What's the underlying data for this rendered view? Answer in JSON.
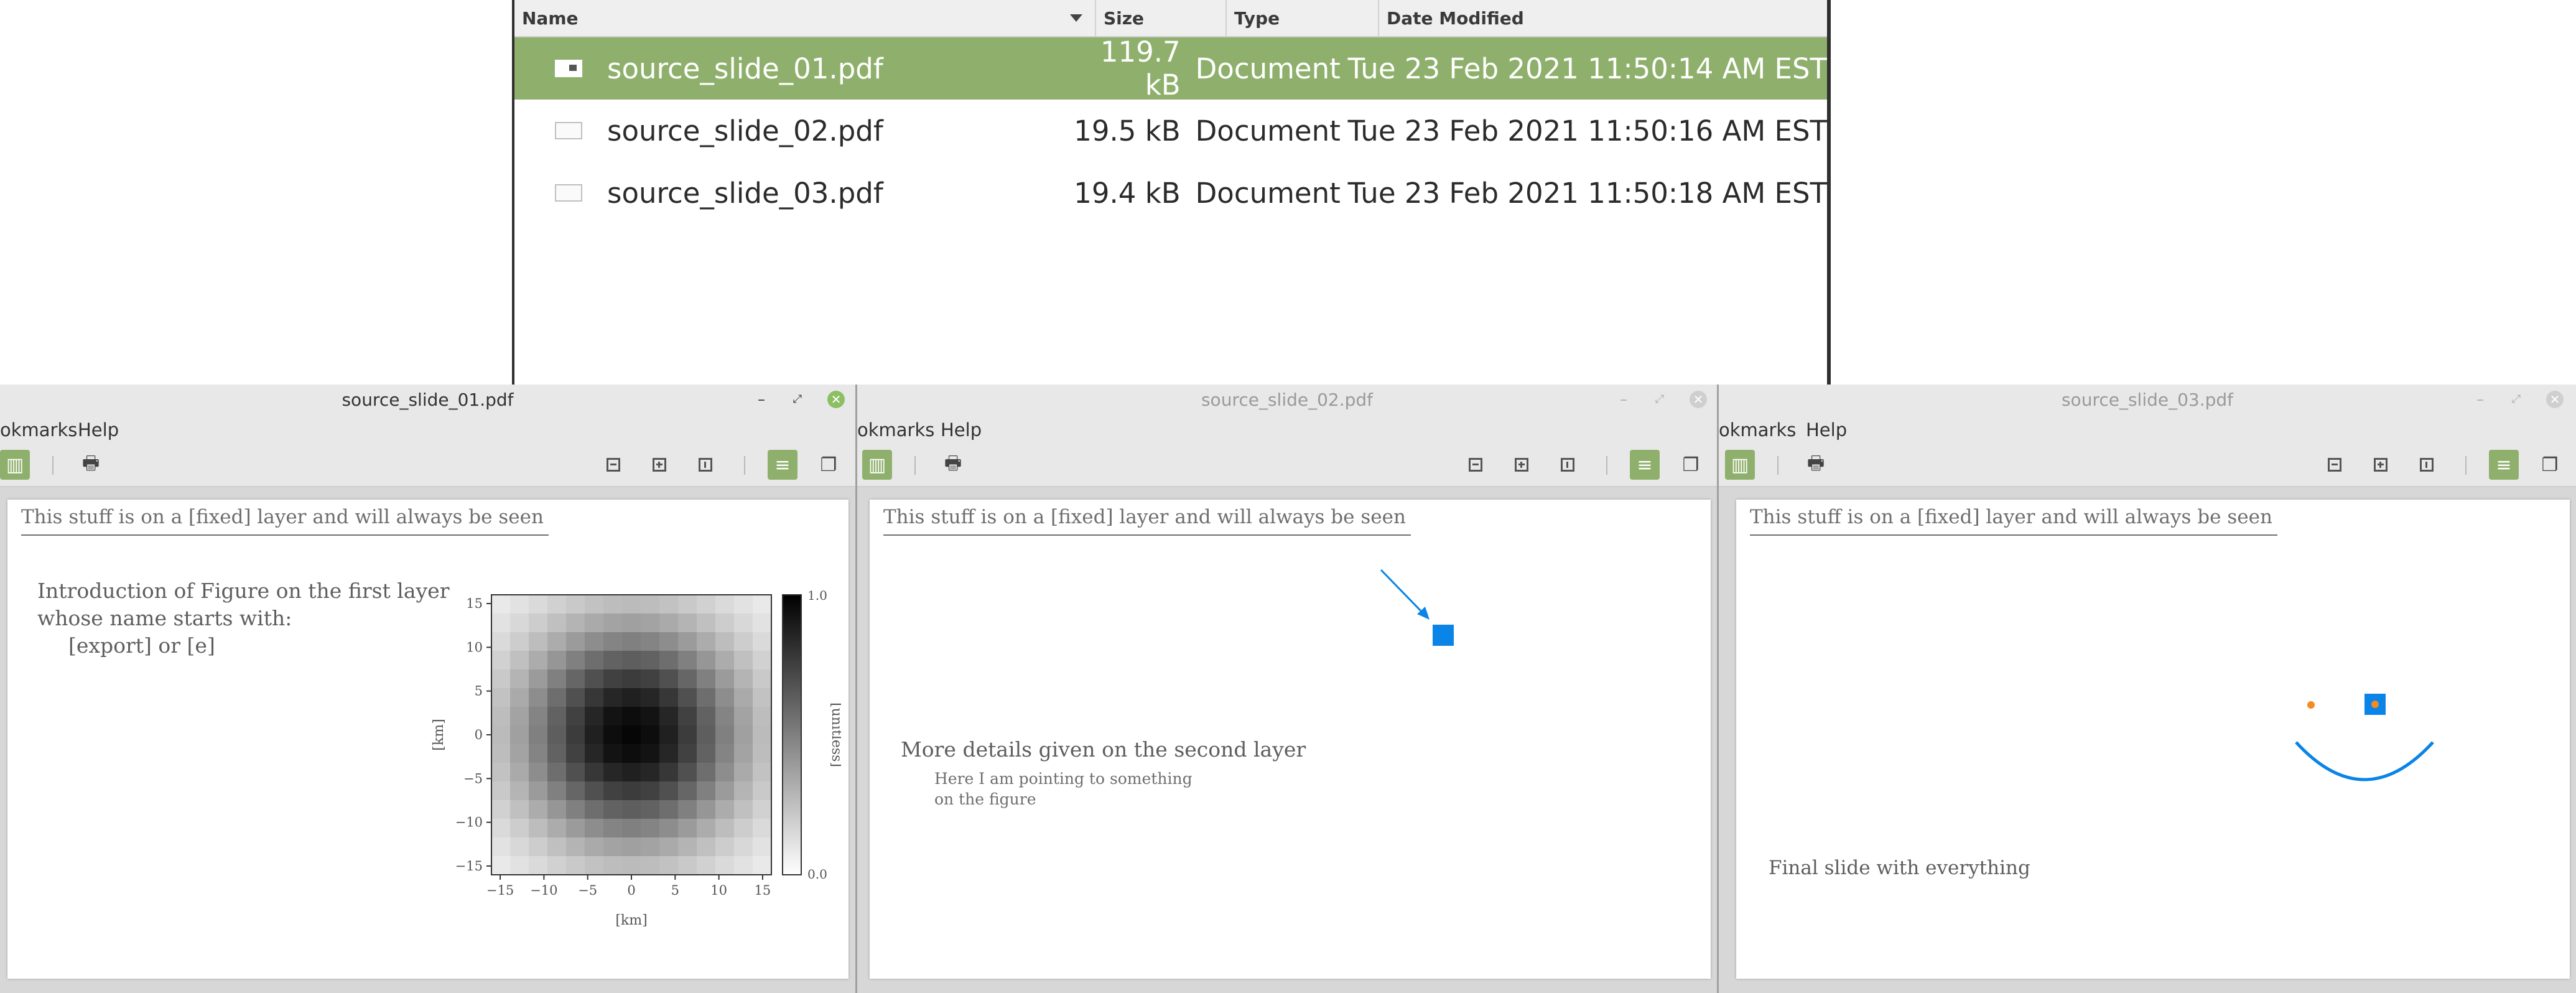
{
  "file_manager": {
    "columns": {
      "name": "Name",
      "size": "Size",
      "type": "Type",
      "date": "Date Modified"
    },
    "rows": [
      {
        "name": "source_slide_01.pdf",
        "size": "119.7 kB",
        "type": "Document",
        "date": "Tue 23 Feb 2021 11:50:14 AM EST",
        "selected": true
      },
      {
        "name": "source_slide_02.pdf",
        "size": "19.5 kB",
        "type": "Document",
        "date": "Tue 23 Feb 2021 11:50:16 AM EST"
      },
      {
        "name": "source_slide_03.pdf",
        "size": "19.4 kB",
        "type": "Document",
        "date": "Tue 23 Feb 2021 11:50:18 AM EST"
      }
    ]
  },
  "viewers": [
    {
      "title": "source_slide_01.pdf",
      "menu": [
        "okmarks",
        "Help"
      ],
      "fixed_text": "This stuff is on a [fixed] layer and will always be seen",
      "intro_lines": [
        "Introduction of Figure on the first layer",
        "whose name starts with:",
        "[export] or [e]"
      ],
      "chart_data": {
        "type": "heatmap",
        "x_ticks": [
          "−15",
          "−10",
          "−5",
          "0",
          "5",
          "10",
          "15"
        ],
        "y_ticks": [
          "15",
          "10",
          "5",
          "0",
          "−5",
          "−10",
          "−15"
        ],
        "xlabel": "[km]",
        "ylabel": "[km]",
        "colorbar_label": "[unitless]",
        "colorbar_ticks": [
          "1.0",
          "0.0"
        ],
        "xlim": [
          -16,
          16
        ],
        "ylim": [
          -16,
          16
        ],
        "clim": [
          0.0,
          1.0
        ],
        "grid_size": 15,
        "colormap": "greys",
        "pattern": "2D Gaussian, peak 1.0 at (0, 0)"
      }
    },
    {
      "title": "source_slide_02.pdf",
      "menu": [
        "okmarks",
        "Help"
      ],
      "fixed_text": "This stuff is on a [fixed] layer and will always be seen",
      "heading": "More details given on the second layer",
      "sub_lines": [
        "Here I am pointing to something",
        "on the figure"
      ],
      "shape_color": "#0a84e6"
    },
    {
      "title": "source_slide_03.pdf",
      "menu": [
        "okmarks",
        "Help"
      ],
      "fixed_text": "This stuff is on a [fixed] layer and will always be seen",
      "heading": "Final slide with everything",
      "shape_color": "#0a84e6",
      "dot_color": "#f58a1f"
    }
  ],
  "colors": {
    "selection": "#8fb06c",
    "window_chrome": "#e8e8e8"
  }
}
